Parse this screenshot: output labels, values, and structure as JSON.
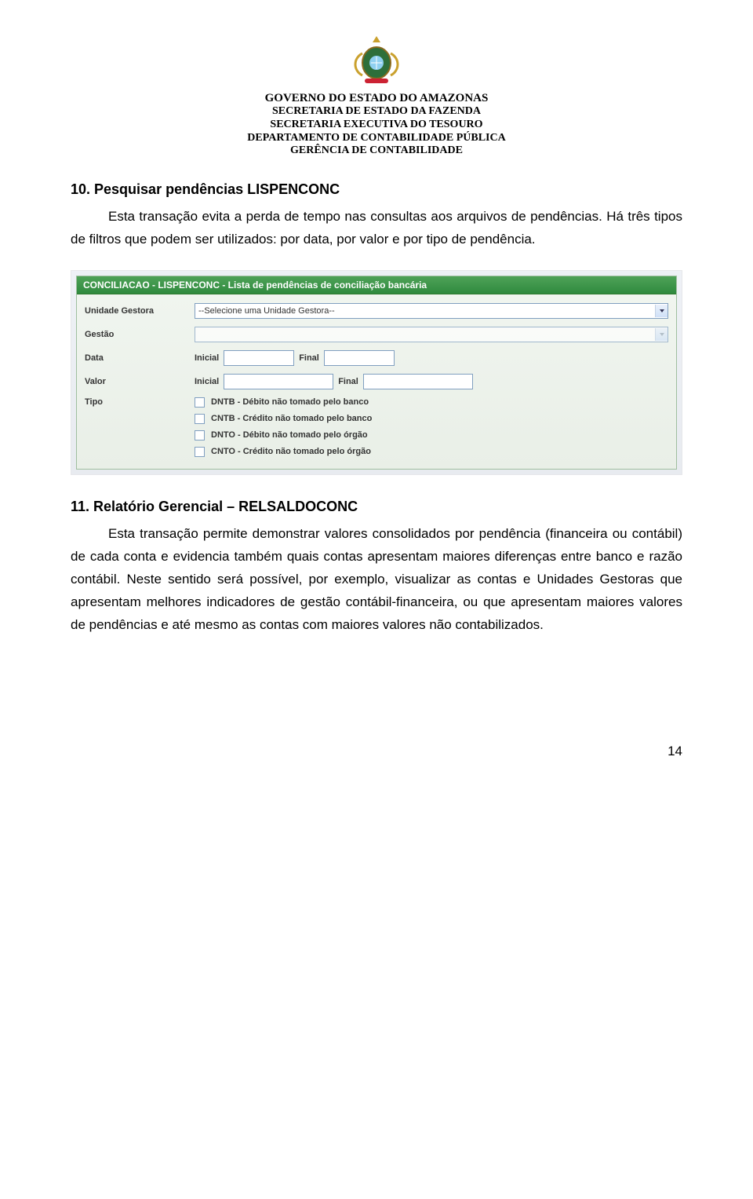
{
  "header": {
    "line1": "GOVERNO DO ESTADO DO AMAZONAS",
    "line2": "SECRETARIA DE ESTADO DA FAZENDA",
    "line3": "SECRETARIA EXECUTIVA DO TESOURO",
    "line4": "DEPARTAMENTO DE CONTABILIDADE PÚBLICA",
    "line5": "GERÊNCIA DE CONTABILIDADE"
  },
  "section10": {
    "title": "10. Pesquisar pendências LISPENCONC",
    "para": "Esta transação evita a perda de tempo nas consultas aos arquivos de pendências. Há três tipos de filtros que podem ser utilizados: por data, por valor e por tipo de pendência."
  },
  "form": {
    "titlebar": "CONCILIACAO - LISPENCONC - Lista de pendências de conciliação bancária",
    "labels": {
      "unidade_gestora": "Unidade Gestora",
      "gestao": "Gestão",
      "data": "Data",
      "valor": "Valor",
      "tipo": "Tipo",
      "inicial": "Inicial",
      "final": "Final"
    },
    "unidade_gestora_placeholder": "--Selecione uma Unidade Gestora--",
    "tipos": [
      "DNTB - Débito não tomado pelo banco",
      "CNTB - Crédito não tomado pelo banco",
      "DNTO - Débito não tomado pelo órgão",
      "CNTO - Crédito não tomado pelo órgão"
    ]
  },
  "section11": {
    "title": "11. Relatório Gerencial – RELSALDOCONC",
    "para": "Esta transação permite demonstrar valores consolidados por pendência (financeira ou contábil) de cada conta e evidencia também quais contas apresentam maiores diferenças entre banco e razão contábil. Neste sentido será possível, por exemplo, visualizar as contas e Unidades Gestoras que apresentam melhores indicadores de gestão contábil-financeira, ou que apresentam maiores valores de pendências e até mesmo as contas com maiores valores não contabilizados."
  },
  "page_number": "14"
}
